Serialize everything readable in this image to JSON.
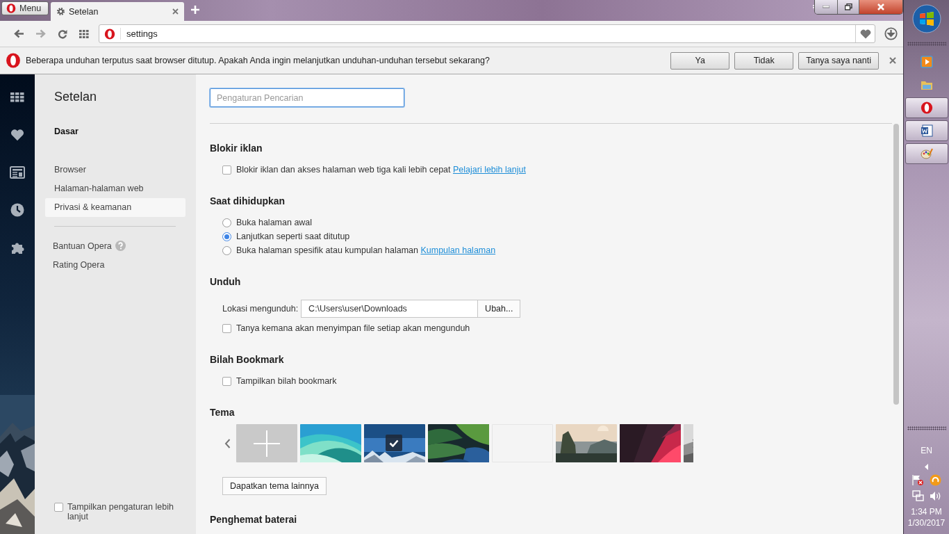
{
  "tab_strip": {
    "menu_button": "Menu",
    "tabs": [
      {
        "label": "Setelan",
        "selected": true
      }
    ]
  },
  "address_bar": {
    "url": "settings"
  },
  "infobar": {
    "message": "Beberapa unduhan terputus saat browser ditutup. Apakah Anda ingin melanjutkan unduhan-unduhan tersebut sekarang?",
    "buttons": [
      "Ya",
      "Tidak",
      "Tanya saya nanti"
    ]
  },
  "nav": {
    "title": "Setelan",
    "section": "Dasar",
    "items": [
      {
        "label": "Browser",
        "selected": false
      },
      {
        "label": "Halaman-halaman web",
        "selected": false
      },
      {
        "label": "Privasi & keamanan",
        "selected": true
      }
    ],
    "help_links": [
      {
        "label": "Bantuan Opera",
        "help_icon": true
      },
      {
        "label": "Rating Opera",
        "help_icon": false
      }
    ],
    "advanced": {
      "label": "Tampilkan pengaturan lebih lanjut",
      "checked": false
    }
  },
  "search": {
    "placeholder": "Pengaturan Pencarian"
  },
  "sections": [
    {
      "title": "Blokir iklan",
      "rows": [
        {
          "kind": "checkbox",
          "label": "Blokir iklan dan akses halaman web tiga kali lebih cepat",
          "link": "Pelajari lebih lanjut",
          "checked": false
        }
      ]
    },
    {
      "title": "Saat dihidupkan",
      "rows": [
        {
          "kind": "radio",
          "label": "Buka halaman awal",
          "selected": false
        },
        {
          "kind": "radio",
          "label": "Lanjutkan seperti saat ditutup",
          "selected": true
        },
        {
          "kind": "radio",
          "label": "Buka halaman spesifik atau kumpulan halaman",
          "link": "Kumpulan halaman",
          "selected": false
        }
      ]
    },
    {
      "title": "Unduh",
      "rows": [
        {
          "kind": "path",
          "label": "Lokasi mengunduh:",
          "value": "C:\\Users\\user\\Downloads",
          "button": "Ubah..."
        },
        {
          "kind": "checkbox",
          "label": "Tanya kemana akan menyimpan file setiap akan mengunduh",
          "checked": false
        }
      ]
    },
    {
      "title": "Bilah Bookmark",
      "rows": [
        {
          "kind": "checkbox",
          "label": "Tampilkan bilah bookmark",
          "checked": false
        }
      ]
    },
    {
      "title": "Tema",
      "rows": [
        {
          "kind": "themes",
          "button": "Dapatkan tema lainnya",
          "items": [
            {
              "kind": "add",
              "selected": false
            },
            {
              "kind": "picture",
              "selected": false
            },
            {
              "kind": "picture",
              "selected": true
            },
            {
              "kind": "picture",
              "selected": false
            },
            {
              "kind": "blank",
              "selected": false
            },
            {
              "kind": "picture",
              "selected": false
            },
            {
              "kind": "picture",
              "selected": false
            },
            {
              "kind": "picture",
              "selected": false
            }
          ]
        }
      ]
    },
    {
      "title": "Penghemat baterai"
    }
  ],
  "taskbar": {
    "apps": [
      {
        "kind": "media",
        "running": false
      },
      {
        "kind": "folder",
        "running": false
      },
      {
        "kind": "opera",
        "running": true
      },
      {
        "kind": "word",
        "running": true
      },
      {
        "kind": "paint",
        "running": true
      }
    ],
    "language": "EN",
    "time": "1:34 PM",
    "date": "1/30/2017"
  }
}
